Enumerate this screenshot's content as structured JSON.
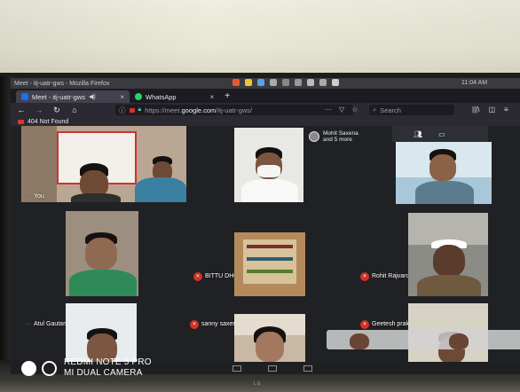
{
  "os_bar": {
    "window_title": "Meet - itj-uatr-gws - Mozilla Firefox",
    "clock": "11:04 AM"
  },
  "tabs": [
    {
      "label": "Meet - itj-uatr-gws",
      "icon": "google-meet-icon",
      "active": true
    },
    {
      "label": "WhatsApp",
      "icon": "whatsapp-icon",
      "active": false
    }
  ],
  "navbar": {
    "url_prefix": "https://meet.",
    "url_host": "google.com",
    "url_path": "/itj-uatr-gws/",
    "search_placeholder": "Search",
    "more_label": "···"
  },
  "bookmarks": [
    {
      "label": "404 Not Found",
      "icon": "youtube-icon"
    }
  ],
  "meet": {
    "more_people": {
      "line1": "Mohit Saxena",
      "line2": "and 5 more"
    },
    "participants": [
      {
        "id": "you",
        "name": "You",
        "muted": false
      },
      {
        "id": "bittu",
        "name": "BITTU DHOREA",
        "muted": true
      },
      {
        "id": "rohit",
        "name": "Rohit Rajvardhan",
        "muted": true
      },
      {
        "id": "atul",
        "name": "Atul Gautam",
        "muted": false
      },
      {
        "id": "sanny",
        "name": "sanny saxena",
        "muted": true
      },
      {
        "id": "geetesh",
        "name": "Geetesh prakash Jatav",
        "muted": true
      },
      {
        "id": "p7",
        "name": "",
        "muted": false
      },
      {
        "id": "p8",
        "name": "",
        "muted": false
      },
      {
        "id": "p9",
        "name": "",
        "muted": false
      }
    ]
  },
  "watermark": {
    "line1": "REDMI NOTE 5 PRO",
    "line2": "MI DUAL CAMERA"
  },
  "tv_brand": "LG",
  "colors": {
    "meet_bg": "#202124",
    "mute_red": "#d93025",
    "firefox_toolbar": "#2b2a33"
  }
}
